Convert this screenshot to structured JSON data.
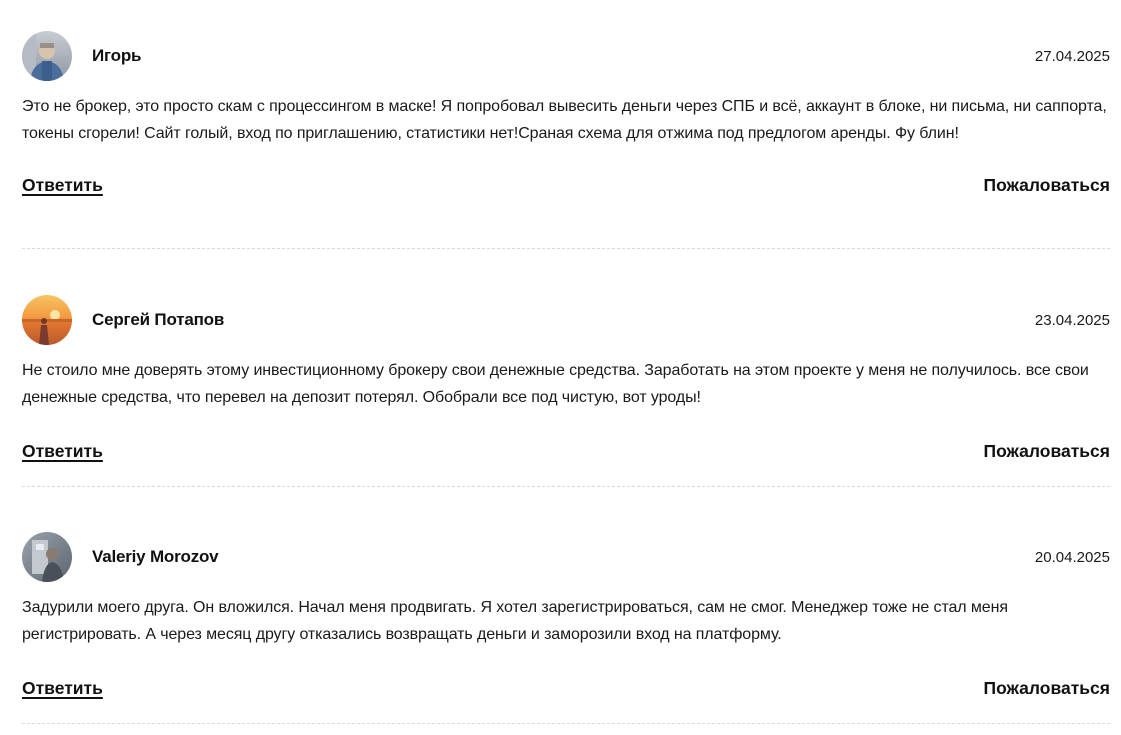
{
  "reviews": [
    {
      "author": "Игорь",
      "date": "27.04.2025",
      "text": "Это не брокер, это просто скам с процессингом в маске! Я попробовал вывесить деньги через СПБ и всё, аккаунт в блоке, ни письма, ни саппорта, токены сгорели! Сайт голый, вход по приглашению, статистики нет!Сраная схема для отжима под предлогом аренды. Фу блин!",
      "reply_label": "Ответить",
      "report_label": "Пожаловаться"
    },
    {
      "author": "Сергей Потапов",
      "date": "23.04.2025",
      "text": "Не стоило мне доверять этому инвестиционному брокеру свои денежные средства. Заработать на этом проекте у меня не получилось. все свои денежные средства, что перевел на депозит потерял. Обобрали все под чистую, вот уроды!",
      "reply_label": "Ответить",
      "report_label": "Пожаловаться"
    },
    {
      "author": "Valeriy Morozov",
      "date": "20.04.2025",
      "text": "Задурили моего друга. Он вложился. Начал меня продвигать. Я хотел зарегистрироваться, сам не смог. Менеджер тоже не стал меня регистрировать. А через месяц другу отказались возвращать деньги и заморозили вход на платформу.",
      "reply_label": "Ответить",
      "report_label": "Пожаловаться"
    }
  ]
}
